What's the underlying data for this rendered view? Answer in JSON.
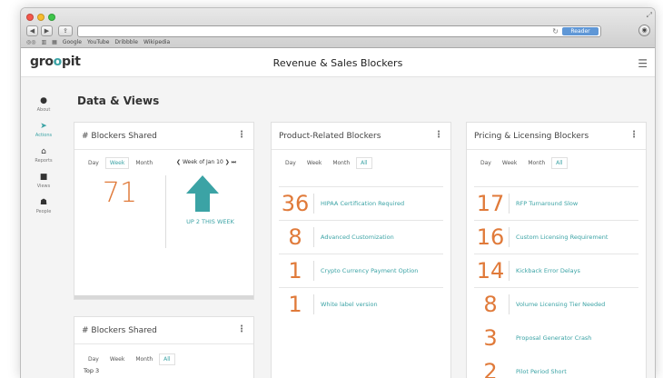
{
  "browser": {
    "reader_label": "Reader",
    "bookmarks": [
      "Google",
      "YouTube",
      "Dribbble",
      "Wikipedia"
    ]
  },
  "app": {
    "logo": {
      "part1": "gro",
      "part2": "o",
      "part3": "pit"
    },
    "title": "Revenue & Sales Blockers"
  },
  "sidebar": {
    "items": [
      {
        "label": "About",
        "icon": "info-icon"
      },
      {
        "label": "Actions",
        "icon": "arrow-icon"
      },
      {
        "label": "Reports",
        "icon": "home-icon"
      },
      {
        "label": "Views",
        "icon": "square-icon"
      },
      {
        "label": "People",
        "icon": "people-icon"
      }
    ],
    "active": "Actions"
  },
  "section": {
    "title": "Data & Views"
  },
  "blockers_card": {
    "title": "# Blockers Shared",
    "tabs": [
      "Day",
      "Week",
      "Month"
    ],
    "selected_tab": "Week",
    "week_nav": "Week of Jan 10",
    "count": "71",
    "trend": "UP 2 THIS WEEK"
  },
  "blockers_card_2": {
    "title": "# Blockers Shared",
    "tabs": [
      "Day",
      "Week",
      "Month",
      "All"
    ],
    "selected_tab": "All",
    "subtitle": "Top 3"
  },
  "product_card": {
    "title": "Product-Related Blockers",
    "tabs": [
      "Day",
      "Week",
      "Month",
      "All"
    ],
    "selected_tab": "All",
    "rows": [
      {
        "count": "36",
        "label": "HIPAA Certification Required"
      },
      {
        "count": "8",
        "label": "Advanced Customization"
      },
      {
        "count": "1",
        "label": "Crypto Currency Payment Option"
      },
      {
        "count": "1",
        "label": "White label version"
      }
    ]
  },
  "pricing_card": {
    "title": "Pricing & Licensing Blockers",
    "tabs": [
      "Day",
      "Week",
      "Month",
      "All"
    ],
    "selected_tab": "All",
    "rows": [
      {
        "count": "17",
        "label": "RFP Turnaround Slow"
      },
      {
        "count": "16",
        "label": "Custom Licensing Requirement"
      },
      {
        "count": "14",
        "label": "Kickback Error Delays"
      },
      {
        "count": "8",
        "label": "Volume Licensing Tier Needed"
      },
      {
        "count": "3",
        "label": "Proposal Generator Crash"
      },
      {
        "count": "2",
        "label": "Pilot Period Short"
      }
    ]
  },
  "colors": {
    "accent": "#3ba3a5",
    "number": "#e07a3a"
  }
}
